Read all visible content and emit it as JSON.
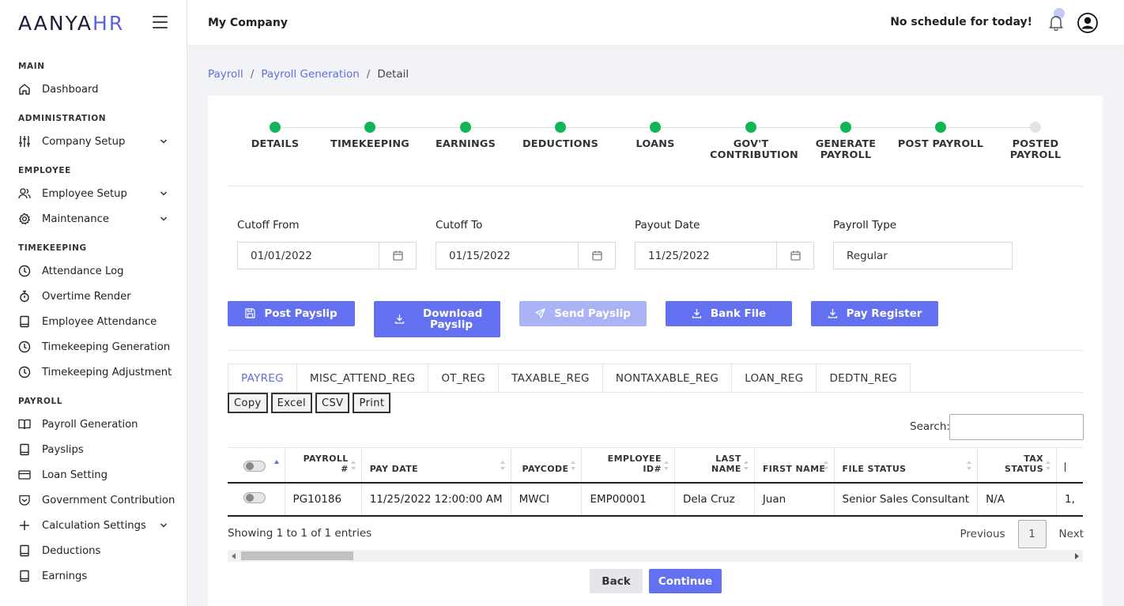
{
  "brand": {
    "name_main": "AANYA",
    "name_accent": "HR"
  },
  "header": {
    "company": "My Company",
    "schedule_text": "No schedule for today!"
  },
  "sidebar": {
    "sections": [
      {
        "title": "MAIN",
        "items": [
          {
            "label": "Dashboard",
            "icon": "home-icon",
            "chevron": false
          }
        ]
      },
      {
        "title": "ADMINISTRATION",
        "items": [
          {
            "label": "Company Setup",
            "icon": "sliders-icon",
            "chevron": true
          }
        ]
      },
      {
        "title": "EMPLOYEE",
        "items": [
          {
            "label": "Employee Setup",
            "icon": "users-icon",
            "chevron": true
          },
          {
            "label": "Maintenance",
            "icon": "gear-icon",
            "chevron": true
          }
        ]
      },
      {
        "title": "TIMEKEEPING",
        "items": [
          {
            "label": "Attendance Log",
            "icon": "clock-icon",
            "chevron": false
          },
          {
            "label": "Overtime Render",
            "icon": "stopwatch-icon",
            "chevron": false
          },
          {
            "label": "Employee Attendance",
            "icon": "tablet-icon",
            "chevron": false
          },
          {
            "label": "Timekeeping Generation",
            "icon": "clock-icon",
            "chevron": false
          },
          {
            "label": "Timekeeping Adjustment",
            "icon": "clock-icon",
            "chevron": false
          }
        ]
      },
      {
        "title": "PAYROLL",
        "items": [
          {
            "label": "Payroll Generation",
            "icon": "book-icon",
            "chevron": false
          },
          {
            "label": "Payslips",
            "icon": "tablet-icon",
            "chevron": false
          },
          {
            "label": "Loan Setting",
            "icon": "card-icon",
            "chevron": false
          },
          {
            "label": "Government Contribution",
            "icon": "shield-icon",
            "chevron": false
          },
          {
            "label": "Calculation Settings",
            "icon": "plus-icon",
            "chevron": true
          },
          {
            "label": "Deductions",
            "icon": "tablet-icon",
            "chevron": false
          },
          {
            "label": "Earnings",
            "icon": "tablet-icon",
            "chevron": false
          }
        ]
      }
    ]
  },
  "breadcrumb": {
    "items": [
      "Payroll",
      "Payroll Generation"
    ],
    "current": "Detail",
    "separator": "/"
  },
  "steps": [
    {
      "label": "DETAILS",
      "done": true
    },
    {
      "label": "TIMEKEEPING",
      "done": true
    },
    {
      "label": "EARNINGS",
      "done": true
    },
    {
      "label": "DEDUCTIONS",
      "done": true
    },
    {
      "label": "LOANS",
      "done": true
    },
    {
      "label": "GOV'T CONTRIBUTION",
      "done": true
    },
    {
      "label": "GENERATE PAYROLL",
      "done": true
    },
    {
      "label": "POST PAYROLL",
      "done": true
    },
    {
      "label": "POSTED PAYROLL",
      "done": false
    }
  ],
  "form": {
    "cutoff_from": {
      "label": "Cutoff From",
      "value": "01/01/2022"
    },
    "cutoff_to": {
      "label": "Cutoff To",
      "value": "01/15/2022"
    },
    "payout_date": {
      "label": "Payout Date",
      "value": "11/25/2022"
    },
    "payroll_type": {
      "label": "Payroll Type",
      "value": "Regular"
    }
  },
  "actions": {
    "post_payslip": "Post Payslip",
    "download_payslip": "Download Payslip",
    "send_payslip": "Send Payslip",
    "bank_file": "Bank File",
    "pay_register": "Pay Register"
  },
  "tabs": [
    "PAYREG",
    "MISC_ATTEND_REG",
    "OT_REG",
    "TAXABLE_REG",
    "NONTAXABLE_REG",
    "LOAN_REG",
    "DEDTN_REG"
  ],
  "table_tools": {
    "buttons": [
      "Copy",
      "Excel",
      "CSV",
      "Print"
    ],
    "search_label": "Search:",
    "search_value": ""
  },
  "table": {
    "columns": [
      "PAYROLL #",
      "PAY DATE",
      "PAYCODE",
      "EMPLOYEE ID#",
      "LAST NAME",
      "FIRST NAME",
      "FILE STATUS",
      "TAX STATUS"
    ],
    "rows": [
      [
        "PG10186",
        "11/25/2022 12:00:00 AM",
        "MWCI",
        "EMP00001",
        "Dela Cruz",
        "Juan",
        "Senior Sales Consultant",
        "N/A",
        "1,"
      ]
    ]
  },
  "footer": {
    "showing": "Showing 1 to 1 of 1 entries",
    "previous": "Previous",
    "page": "1",
    "next": "Next",
    "back": "Back",
    "continue": "Continue"
  },
  "colors": {
    "accent": "#6370f0",
    "step_done": "#10b557",
    "step_pending": "#e3e3e6"
  }
}
